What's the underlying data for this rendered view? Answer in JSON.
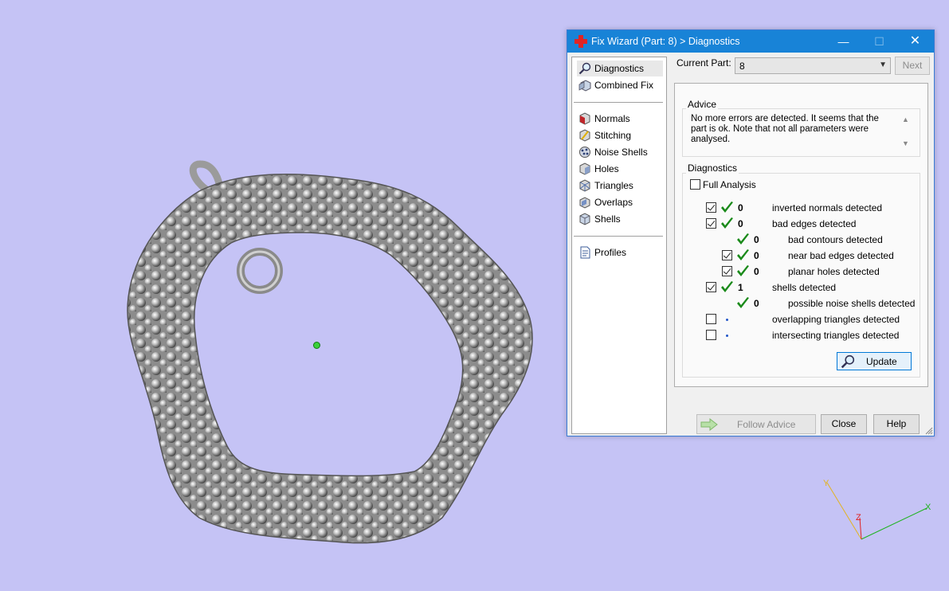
{
  "viewport": {
    "background": "#c5c3f5",
    "axis_labels": {
      "x": "X",
      "y": "Y",
      "z": "Z"
    }
  },
  "window": {
    "title": "Fix Wizard (Part: 8) > Diagnostics",
    "controls": {
      "minimize": "—",
      "maximize": "☐",
      "close": "✕"
    }
  },
  "nav": {
    "items": [
      {
        "label": "Diagnostics",
        "icon": "magnifier-icon",
        "selected": true
      },
      {
        "label": "Combined Fix",
        "icon": "combined-fix-icon"
      },
      {
        "label": "Normals",
        "icon": "normals-icon"
      },
      {
        "label": "Stitching",
        "icon": "stitching-icon"
      },
      {
        "label": "Noise Shells",
        "icon": "noise-shells-icon"
      },
      {
        "label": "Holes",
        "icon": "holes-icon"
      },
      {
        "label": "Triangles",
        "icon": "triangles-icon"
      },
      {
        "label": "Overlaps",
        "icon": "overlaps-icon"
      },
      {
        "label": "Shells",
        "icon": "shells-icon"
      },
      {
        "label": "Profiles",
        "icon": "profiles-icon"
      }
    ]
  },
  "current_part": {
    "label": "Current Part:",
    "value": "8",
    "next_label": "Next"
  },
  "advice": {
    "title": "Advice",
    "text": "No more errors are detected. It seems that the part is ok. Note that not all parameters were analysed."
  },
  "diagnostics": {
    "title": "Diagnostics",
    "full_analysis_label": "Full Analysis",
    "full_analysis_checked": false,
    "rows": [
      {
        "checkbox": true,
        "checked": true,
        "status": "ok",
        "count": "0",
        "label": "inverted normals detected",
        "indent": 0
      },
      {
        "checkbox": true,
        "checked": true,
        "status": "ok",
        "count": "0",
        "label": "bad edges detected",
        "indent": 0
      },
      {
        "checkbox": false,
        "checked": false,
        "status": "ok",
        "count": "0",
        "label": "bad contours detected",
        "indent": 1
      },
      {
        "checkbox": true,
        "checked": true,
        "status": "ok",
        "count": "0",
        "label": "near bad edges detected",
        "indent": 1
      },
      {
        "checkbox": true,
        "checked": true,
        "status": "ok",
        "count": "0",
        "label": "planar holes detected",
        "indent": 1
      },
      {
        "checkbox": true,
        "checked": true,
        "status": "ok",
        "count": "1",
        "label": "shells detected",
        "indent": 0
      },
      {
        "checkbox": false,
        "checked": false,
        "status": "ok",
        "count": "0",
        "label": "possible noise shells detected",
        "indent": 1
      },
      {
        "checkbox": true,
        "checked": false,
        "status": "pending",
        "count": "",
        "label": "overlapping triangles detected",
        "indent": 0
      },
      {
        "checkbox": true,
        "checked": false,
        "status": "pending",
        "count": "",
        "label": "intersecting triangles detected",
        "indent": 0
      }
    ],
    "update_label": "Update"
  },
  "footer": {
    "follow_advice_label": "Follow Advice",
    "close_label": "Close",
    "help_label": "Help"
  },
  "colors": {
    "titlebar": "#1883d7",
    "ok_tick": "#1a8a1a",
    "pending_dot": "#2356c8",
    "model_metal": "#9a9a9a"
  }
}
